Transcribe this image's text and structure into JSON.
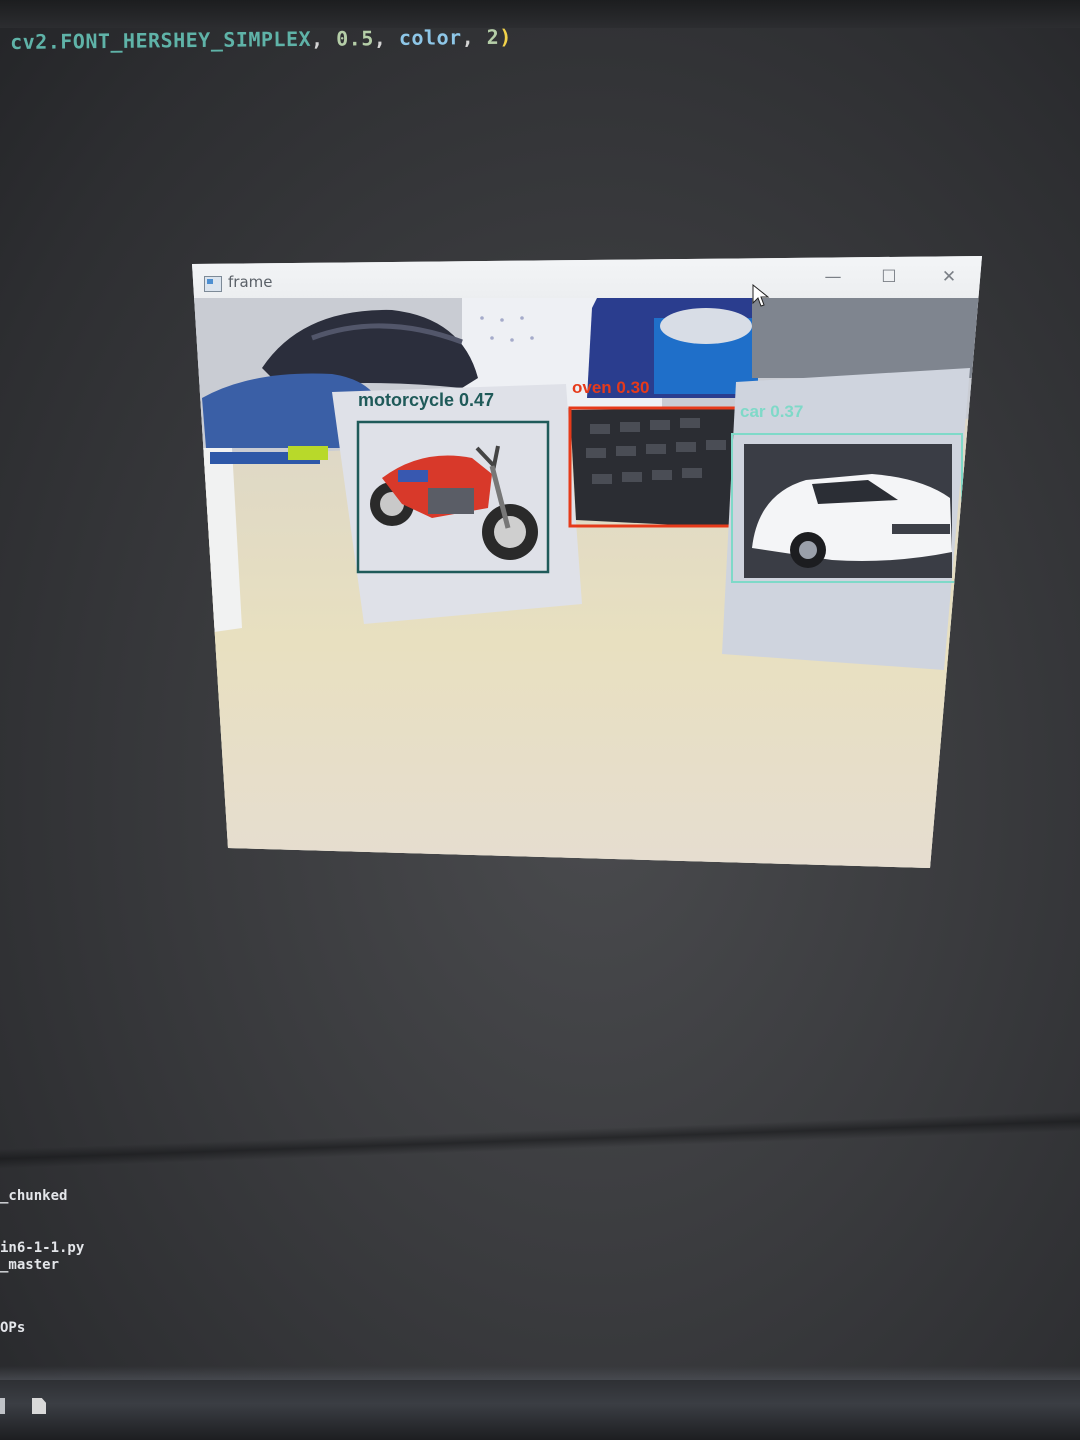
{
  "editor": {
    "code_line": {
      "obj": "cv2.FONT_HERSHEY_SIMPLEX",
      "sep1": ", ",
      "num": "0.5",
      "sep2": ", ",
      "param": "color",
      "sep3": ", ",
      "num2": "2",
      "close_paren": ")"
    }
  },
  "frame_window": {
    "title": "frame",
    "minimize_glyph": "—",
    "maximize_glyph": "☐",
    "close_glyph": "✕",
    "detections": [
      {
        "label": "motorcycle 0.47",
        "color": "#1f5a59"
      },
      {
        "label": "oven 0.30",
        "color": "#e63a1a"
      },
      {
        "label": "car 0.37",
        "color": "#7fd9c8"
      }
    ]
  },
  "terminal": {
    "lines": [
      "_chunked",
      "in6-1-1.py",
      "_master",
      "OPs"
    ]
  },
  "icons": {
    "window_icon": "frame-window-icon",
    "cursor": "mouse-cursor-icon",
    "taskbar_file": "file-icon"
  }
}
